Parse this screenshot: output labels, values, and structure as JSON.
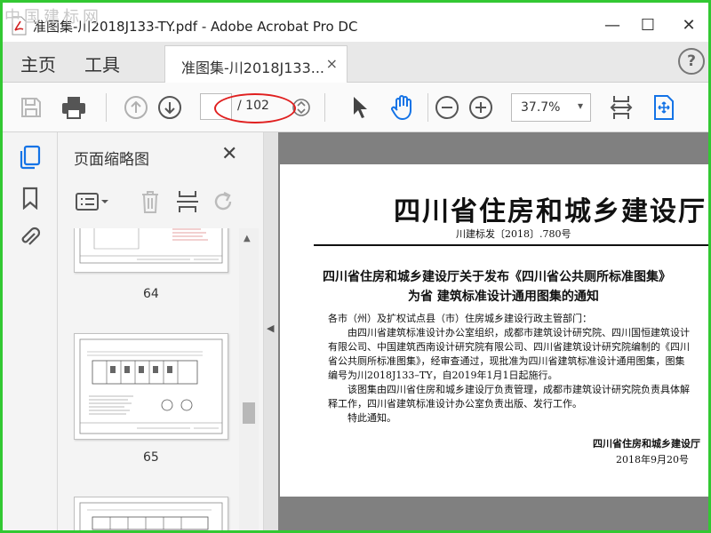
{
  "watermark": "中国建标网",
  "window": {
    "title": "准图集-川2018J133-TY.pdf - Adobe Acrobat Pro DC",
    "minimize": "—",
    "maximize": "☐",
    "close": "✕"
  },
  "nav": {
    "home": "主页",
    "tools": "工具",
    "doc_tab": "准图集-川2018J133...",
    "doc_tab_close": "×",
    "help": "?"
  },
  "toolbar": {
    "page_current": "",
    "page_total": "/ 102",
    "zoom": "37.7%",
    "zoom_caret": "▾"
  },
  "thumbnails": {
    "panel_title": "页面缩略图",
    "close": "✕",
    "pages": [
      {
        "label": "64"
      },
      {
        "label": "65"
      },
      {
        "label": ""
      }
    ]
  },
  "document": {
    "header": "四川省住房和城乡建设厅",
    "doc_number": "川建标发〔2018〕.780号",
    "notice_title_line1": "四川省住房和城乡建设厅关于发布《四川省公共厕所标准图集》",
    "notice_title_line2": "为省 建筑标准设计通用图集的通知",
    "body": [
      "各市（州）及扩权试点县（市）住房城乡建设行政主管部门：",
      "由四川省建筑标准设计办公室组织，成都市建筑设计研究院、四川国恒建筑设计",
      "有限公司、中国建筑西南设计研究院有限公司、四川省建筑设计研究院编制的《四川",
      "省公共厕所标准图集》，经审查通过，现批准为四川省建筑标准设计通用图集，图集",
      "编号为川2018J133–TY，自2019年1月1日起施行。",
      "该图集由四川省住房和城乡建设厅负责管理，成都市建筑设计研究院负责具体解",
      "释工作，四川省建筑标准设计办公室负责出版、发行工作。",
      "特此通知。"
    ],
    "signature": "四川省住房和城乡建设厅",
    "date": "2018年9月20号"
  },
  "colors": {
    "frame_border": "#32c832",
    "annotation_ellipse": "#e02020",
    "accent_blue": "#1473e6"
  }
}
